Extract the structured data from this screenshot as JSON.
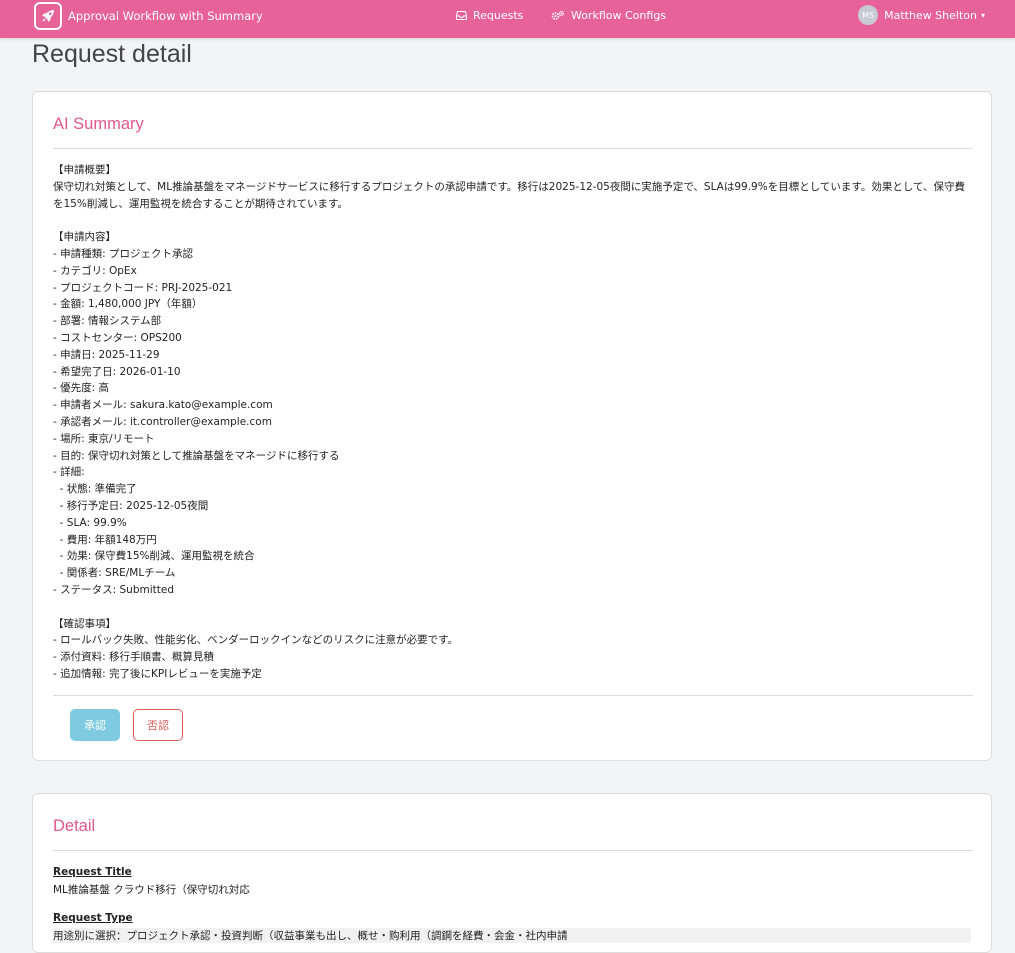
{
  "navbar": {
    "brand": "Approval Workflow with Summary",
    "links": [
      {
        "label": "Requests",
        "icon": "inbox-icon"
      },
      {
        "label": "Workflow Configs",
        "icon": "gears-icon"
      }
    ],
    "user": {
      "initials": "MS",
      "name": "Matthew Shelton"
    }
  },
  "page": {
    "title": "Request detail"
  },
  "summary": {
    "title": "AI Summary",
    "lines": [
      "【申請概要】",
      "保守切れ対策として、ML推論基盤をマネージドサービスに移行するプロジェクトの承認申請です。移行は2025-12-05夜間に実施予定で、SLAは99.9%を目標としています。効果として、保守費を15%削減し、運用監視を統合することが期待されています。",
      "",
      "【申請内容】",
      "- 申請種類: プロジェクト承認",
      "- カテゴリ: OpEx",
      "- プロジェクトコード: PRJ-2025-021",
      "- 金額: 1,480,000 JPY（年額）",
      "- 部署: 情報システム部",
      "- コストセンター: OPS200",
      "- 申請日: 2025-11-29",
      "- 希望完了日: 2026-01-10",
      "- 優先度: 高",
      "- 申請者メール: sakura.kato@example.com",
      "- 承認者メール: it.controller@example.com",
      "- 場所: 東京/リモート",
      "- 目的: 保守切れ対策として推論基盤をマネージドに移行する",
      "- 詳細:",
      "  - 状態: 準備完了",
      "  - 移行予定日: 2025-12-05夜間",
      "  - SLA: 99.9%",
      "  - 費用: 年額148万円",
      "  - 効果: 保守費15%削減、運用監視を統合",
      "  - 関係者: SRE/MLチーム",
      "- ステータス: Submitted",
      "",
      "【確認事項】",
      "- ロールバック失敗、性能劣化、ベンダーロックインなどのリスクに注意が必要です。",
      "- 添付資料: 移行手順書、概算見積",
      "- 追加情報: 完了後にKPIレビューを実施予定"
    ],
    "approve_label": "承認",
    "reject_label": "否認"
  },
  "detail": {
    "title": "Detail",
    "fields": [
      {
        "label": "Request Title",
        "value": "ML推論基盤 クラウド移行（保守切れ対応"
      },
      {
        "label": "Request Type",
        "value": "用途別に選択：プロジェクト承認・投資判断（収益事業も出し、概せ・购利用（調鋼を経費・会金・社内申請"
      }
    ]
  },
  "colors": {
    "navbar": "#e8629a",
    "accent": "#e0568f",
    "approve": "#7ecbe1",
    "reject": "#e35a5a"
  }
}
